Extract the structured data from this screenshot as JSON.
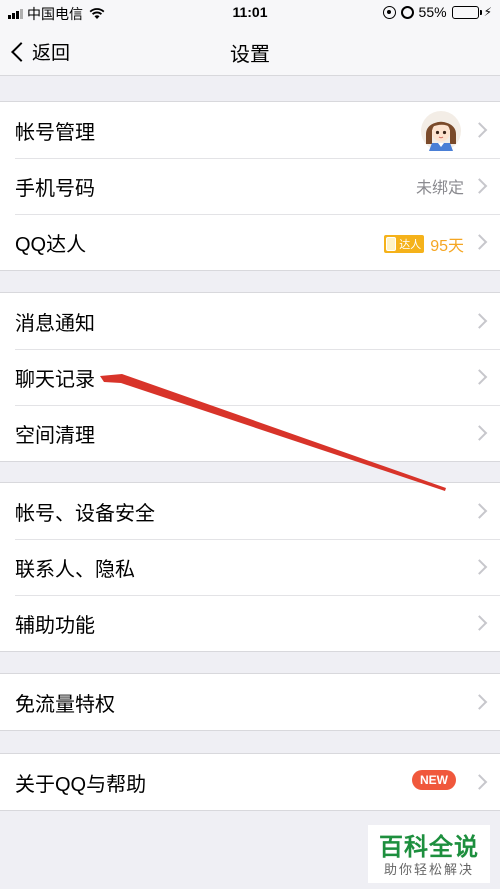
{
  "status_bar": {
    "carrier": "中国电信",
    "time": "11:01",
    "battery_percent": "55%",
    "battery_level": 0.55,
    "icons": [
      "signal-icon",
      "wifi-icon",
      "orientation-lock-icon",
      "alarm-icon",
      "battery-icon",
      "charging-icon"
    ]
  },
  "nav": {
    "back_label": "返回",
    "title": "设置"
  },
  "groups": [
    {
      "items": [
        {
          "label": "帐号管理",
          "accessory": "avatar"
        },
        {
          "label": "手机号码",
          "value": "未绑定"
        },
        {
          "label": "QQ达人",
          "badge_text": "达人",
          "days": "95天"
        }
      ]
    },
    {
      "items": [
        {
          "label": "消息通知"
        },
        {
          "label": "聊天记录"
        },
        {
          "label": "空间清理"
        }
      ]
    },
    {
      "items": [
        {
          "label": "帐号、设备安全"
        },
        {
          "label": "联系人、隐私"
        },
        {
          "label": "辅助功能"
        }
      ]
    },
    {
      "items": [
        {
          "label": "免流量特权"
        }
      ]
    },
    {
      "items": [
        {
          "label": "关于QQ与帮助",
          "badge": "NEW"
        }
      ]
    }
  ],
  "watermark": {
    "title": "百科全说",
    "subtitle": "助你轻松解决"
  },
  "colors": {
    "annotation_arrow": "#d8342a",
    "badge_orange": "#f5b21a",
    "new_badge": "#f0583c",
    "battery_green": "#4cd964"
  }
}
